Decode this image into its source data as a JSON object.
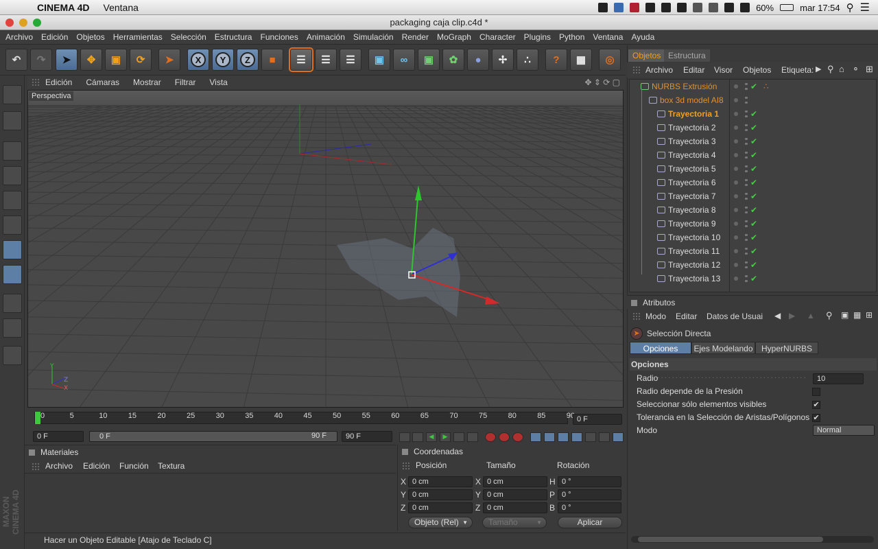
{
  "macbar": {
    "app_name": "CINEMA 4D",
    "menu": "Ventana",
    "battery": "60%",
    "clock": "mar 17:54"
  },
  "window": {
    "title": "packaging caja clip.c4d *"
  },
  "menubar": {
    "items": [
      "Archivo",
      "Edición",
      "Objetos",
      "Herramientas",
      "Selección",
      "Estructura",
      "Funciones",
      "Animación",
      "Simulación",
      "Render",
      "MoGraph",
      "Character",
      "Plugins",
      "Python",
      "Ventana",
      "Ayuda"
    ]
  },
  "toolbar": {
    "axis_x": "X",
    "axis_y": "Y",
    "axis_z": "Z"
  },
  "viewport": {
    "menu": [
      "Edición",
      "Cámaras",
      "Mostrar",
      "Filtrar",
      "Vista"
    ],
    "label": "Perspectiva",
    "axis_y": "Y",
    "axis_x": "X",
    "axis_z": "Z"
  },
  "timeline": {
    "ticks": [
      "0",
      "5",
      "10",
      "15",
      "20",
      "25",
      "30",
      "35",
      "40",
      "45",
      "50",
      "55",
      "60",
      "65",
      "70",
      "75",
      "80",
      "85",
      "90"
    ],
    "current": "0 F",
    "start": "0 F",
    "range_start": "0 F",
    "range_end": "90 F",
    "end": "90 F"
  },
  "materials": {
    "title": "Materiales",
    "menu": [
      "Archivo",
      "Edición",
      "Función",
      "Textura"
    ]
  },
  "coords": {
    "title": "Coordenadas",
    "headers": [
      "Posición",
      "Tamaño",
      "Rotación"
    ],
    "rows": [
      {
        "a": "X",
        "av": "0 cm",
        "b": "X",
        "bv": "0 cm",
        "c": "H",
        "cv": "0 °"
      },
      {
        "a": "Y",
        "av": "0 cm",
        "b": "Y",
        "bv": "0 cm",
        "c": "P",
        "cv": "0 °"
      },
      {
        "a": "Z",
        "av": "0 cm",
        "b": "Z",
        "bv": "0 cm",
        "c": "B",
        "cv": "0 °"
      }
    ],
    "mode": "Objeto (Rel)",
    "size_mode": "Tamaño",
    "apply": "Aplicar"
  },
  "status": {
    "text": "Hacer un Objeto Editable [Atajo de Teclado C]"
  },
  "logo": {
    "text": "MAXON CINEMA 4D"
  },
  "objects": {
    "tabs": [
      "Objetos",
      "Estructura"
    ],
    "menu": [
      "Archivo",
      "Editar",
      "Visor",
      "Objetos",
      "Etiqueta:"
    ],
    "items": [
      "NURBS Extrusión",
      "box 3d model AI8",
      "Trayectoria 1",
      "Trayectoria 2",
      "Trayectoria 3",
      "Trayectoria 4",
      "Trayectoria 5",
      "Trayectoria 6",
      "Trayectoria 7",
      "Trayectoria 8",
      "Trayectoria 9",
      "Trayectoria 10",
      "Trayectoria 11",
      "Trayectoria 12",
      "Trayectoria 13"
    ]
  },
  "attributes": {
    "title": "Atributos",
    "menu": [
      "Modo",
      "Editar",
      "Datos de Usuai"
    ],
    "tool": "Selección Directa",
    "tabs": [
      "Opciones",
      "Ejes Modelando",
      "HyperNURBS"
    ],
    "section": "Opciones",
    "radius_label": "Radio",
    "radius_value": "10",
    "pressure_label": "Radio depende de la Presión",
    "visible_label": "Seleccionar sólo elementos visibles",
    "tolerance_label": "Tolerancia en la Selección de Aristas/Polígonos",
    "mode_label": "Modo",
    "mode_value": "Normal",
    "check": "✔"
  },
  "colors": {
    "accent": "#f0a020",
    "selected_blue": "#5d7fa6",
    "orange_highlight": "#e07020"
  }
}
